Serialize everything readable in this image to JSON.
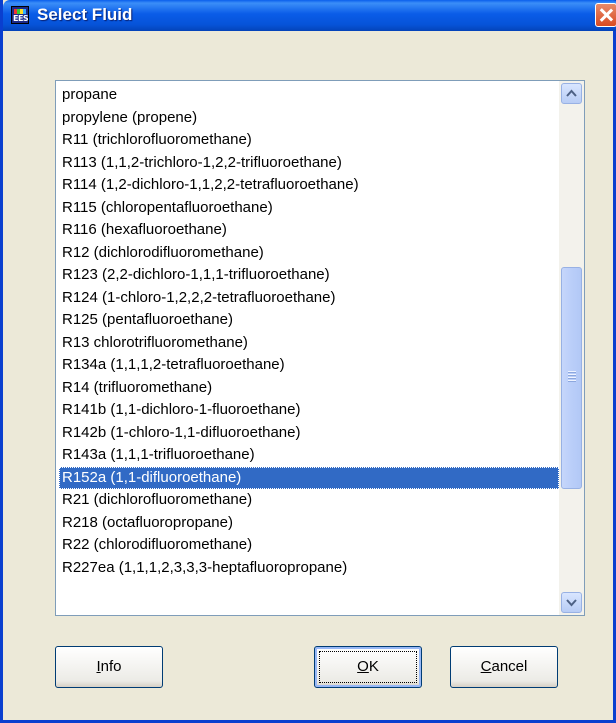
{
  "window": {
    "title": "Select Fluid",
    "app_icon_text": "EES"
  },
  "list": {
    "items": [
      "propane",
      "propylene (propene)",
      "R11 (trichlorofluoromethane)",
      "R113 (1,1,2-trichloro-1,2,2-trifluoroethane)",
      "R114 (1,2-dichloro-1,1,2,2-tetrafluoroethane)",
      "R115 (chloropentafluoroethane)",
      "R116 (hexafluoroethane)",
      "R12 (dichlorodifluoromethane)",
      "R123 (2,2-dichloro-1,1,1-trifluoroethane)",
      "R124 (1-chloro-1,2,2,2-tetrafluoroethane)",
      "R125 (pentafluoroethane)",
      "R13 chlorotrifluoromethane)",
      "R134a (1,1,1,2-tetrafluoroethane)",
      "R14 (trifluoromethane)",
      "R141b (1,1-dichloro-1-fluoroethane)",
      "R142b (1-chloro-1,1-difluoroethane)",
      "R143a (1,1,1-trifluoroethane)",
      "R152a (1,1-difluoroethane)",
      "R21 (dichlorofluoromethane)",
      "R218 (octafluoropropane)",
      "R22 (chlorodifluoromethane)",
      "R227ea (1,1,1,2,3,3,3-heptafluoropropane)"
    ],
    "selected_index": 17
  },
  "buttons": {
    "info": {
      "mnemonic": "I",
      "rest": "nfo"
    },
    "ok": {
      "mnemonic": "O",
      "rest": "K"
    },
    "cancel": {
      "mnemonic": "C",
      "rest": "ancel"
    }
  },
  "colors": {
    "selection": "#316AC5",
    "titlebar": "#0A5CE8",
    "close": "#D94B22"
  },
  "icons": [
    "ees-app-icon",
    "close-icon",
    "scroll-up-arrow-icon",
    "scroll-down-arrow-icon"
  ]
}
